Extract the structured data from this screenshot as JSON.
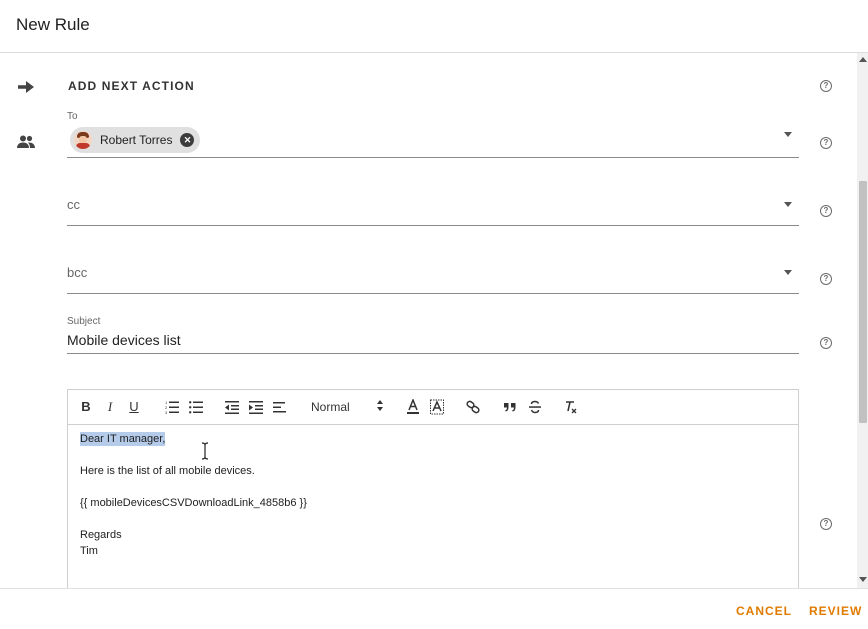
{
  "dialog": {
    "title": "New Rule"
  },
  "action": {
    "section_title": "ADD NEXT ACTION"
  },
  "to": {
    "label": "To",
    "recipients": [
      {
        "name": "Robert Torres"
      }
    ]
  },
  "cc": {
    "placeholder": "cc"
  },
  "bcc": {
    "placeholder": "bcc"
  },
  "subject": {
    "label": "Subject",
    "value": "Mobile devices list"
  },
  "toolbar": {
    "bold": "B",
    "italic": "I",
    "underline": "U",
    "format_select": "Normal"
  },
  "editor": {
    "lines": [
      "Dear IT manager,",
      "Here is the list of all mobile devices.",
      "{{ mobileDevicesCSVDownloadLink_4858b6 }}",
      "Regards",
      "Tim"
    ]
  },
  "footer": {
    "cancel_label": "CANCEL",
    "review_label": "REVIEW"
  },
  "colors": {
    "accent": "#e07b00",
    "highlight": "#b4cbea"
  },
  "icons": {
    "action": "arrow-right-icon",
    "recipients": "people-icon",
    "help": "help-circle-icon",
    "remove_chip": "close-circle-icon"
  }
}
